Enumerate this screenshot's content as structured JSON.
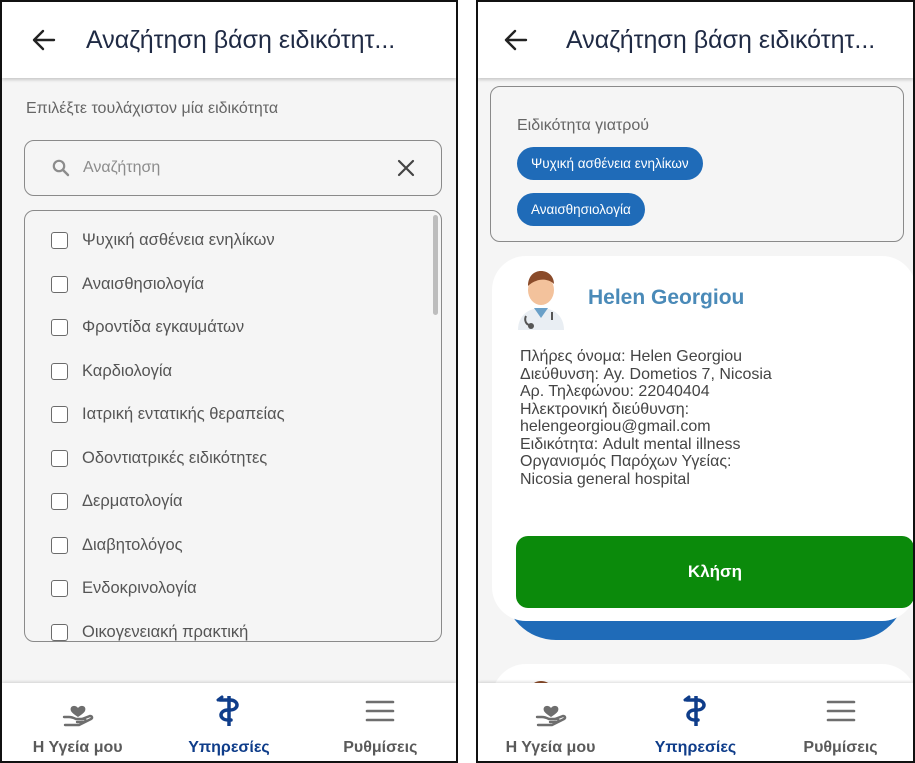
{
  "left": {
    "header": {
      "title": "Αναζήτηση βάση ειδικότητ..."
    },
    "instruction": "Επιλέξτε τουλάχιστον μία ειδικότητα",
    "search": {
      "placeholder": "Αναζήτηση",
      "icon": "search-icon",
      "clear_icon": "close-icon"
    },
    "specialties": [
      "Ψυχική ασθένεια ενηλίκων",
      "Αναισθησιολογία",
      "Φροντίδα εγκαυμάτων",
      "Καρδιολογία",
      "Ιατρική εντατικής θεραπείας",
      "Οδοντιατρικές ειδικότητες",
      "Δερματολογία",
      "Διαβητολόγος",
      "Ενδοκρινολογία",
      "Οικογενειακή πρακτική"
    ]
  },
  "right": {
    "header": {
      "title": "Αναζήτηση βάση ειδικότητ..."
    },
    "selected": {
      "title": "Ειδικότητα γιατρού",
      "chips": [
        "Ψυχική ασθένεια ενηλίκων",
        "Αναισθησιολογία"
      ]
    },
    "doctor": {
      "name": "Helen Georgiou",
      "details": [
        "Πλήρες όνομα:  Helen Georgiou",
        "Διεύθυνση:  Ay. Dometios 7, Nicosia",
        "Αρ. Τηλεφώνου:  22040404",
        "Ηλεκτρονική διεύθυνση:",
        "helengeorgiou@gmail.com",
        "Ειδικότητα:  Adult mental illness",
        "Οργανισμός Παρόχων Υγείας:",
        "Nicosia general hospital"
      ],
      "call_label": "Κλήση"
    }
  },
  "nav": {
    "items": [
      {
        "label": "Η Υγεία μου",
        "icon": "heart-hand-icon"
      },
      {
        "label": "Υπηρεσίες",
        "icon": "caduceus-icon",
        "active": true
      },
      {
        "label": "Ρυθμίσεις",
        "icon": "menu-icon"
      }
    ]
  },
  "colors": {
    "primary": "#0f3d8a",
    "chip": "#1f6bb8",
    "call": "#0b8a0b",
    "doctor_name": "#4a8ab8"
  }
}
